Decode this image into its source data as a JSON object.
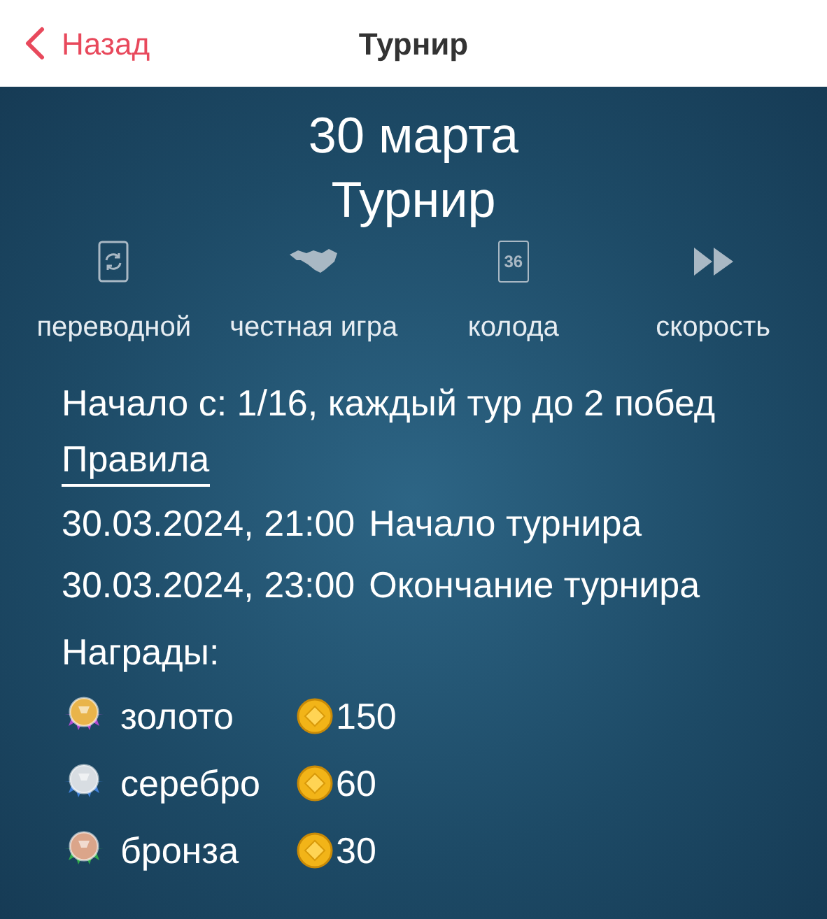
{
  "header": {
    "back": "Назад",
    "title": "Турнир"
  },
  "tournament": {
    "date": "30 марта",
    "name": "Турнир"
  },
  "features": [
    {
      "kind": "transfer",
      "label": "переводной"
    },
    {
      "kind": "fair",
      "label": "честная игра"
    },
    {
      "kind": "deck",
      "label": "колода",
      "icon_text": "36"
    },
    {
      "kind": "speed",
      "label": "скорость"
    }
  ],
  "start_info": "Начало с: 1/16, каждый тур до 2 побед",
  "rules_link": "Правила",
  "schedule": [
    {
      "time": "30.03.2024, 21:00",
      "event": "Начало турнира"
    },
    {
      "time": "30.03.2024, 23:00",
      "event": "Окончание турнира"
    }
  ],
  "rewards_title": "Награды:",
  "rewards": [
    {
      "kind": "gold",
      "color": "#b04ad0",
      "name": "золото",
      "amount": "150"
    },
    {
      "kind": "silver",
      "color": "#3f7fd6",
      "name": "серебро",
      "amount": "60"
    },
    {
      "kind": "bronze",
      "color": "#2fa84a",
      "name": "бронза",
      "amount": "30"
    }
  ]
}
